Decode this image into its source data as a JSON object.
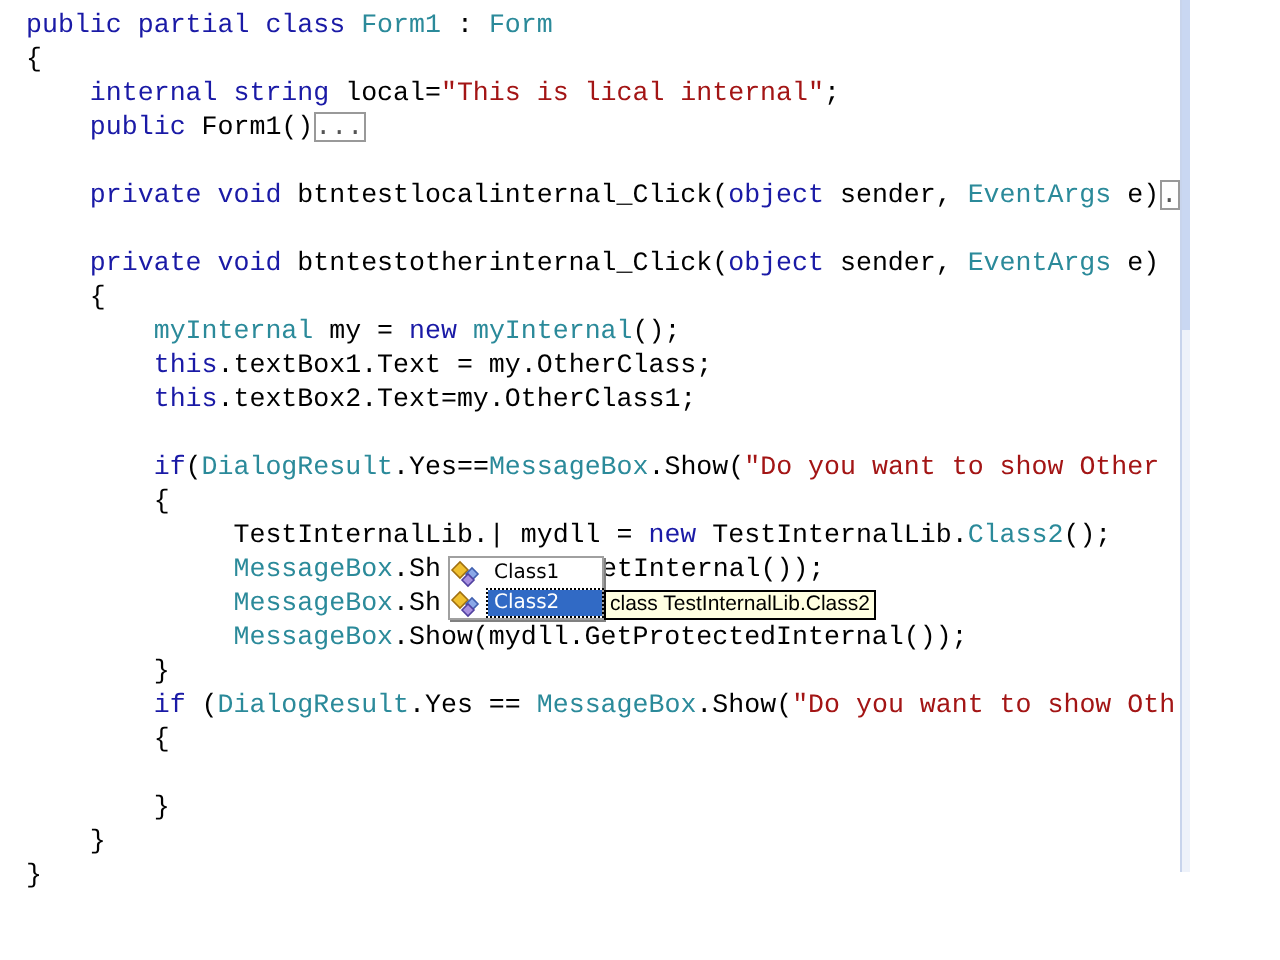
{
  "editor": {
    "lines": [
      {
        "tokens": [
          {
            "text": "public partial class ",
            "kind": "keyword"
          },
          {
            "text": "Form1",
            "kind": "type"
          },
          {
            "text": " : ",
            "kind": "plain"
          },
          {
            "text": "Form",
            "kind": "type"
          }
        ]
      },
      {
        "tokens": [
          {
            "text": "{",
            "kind": "plain"
          }
        ]
      },
      {
        "tokens": [
          {
            "text": "    internal string",
            "kind": "keyword"
          },
          {
            "text": " local=",
            "kind": "plain"
          },
          {
            "text": "\"This is lical internal\"",
            "kind": "string"
          },
          {
            "text": ";",
            "kind": "plain"
          }
        ]
      },
      {
        "tokens": [
          {
            "text": "    public",
            "kind": "keyword"
          },
          {
            "text": " Form1()",
            "kind": "plain"
          },
          {
            "text": "...",
            "kind": "collapsed"
          }
        ]
      },
      {
        "kind": "blank"
      },
      {
        "tokens": [
          {
            "text": "    private void",
            "kind": "keyword"
          },
          {
            "text": " btntestlocalinternal_Click(",
            "kind": "plain"
          },
          {
            "text": "object",
            "kind": "keyword"
          },
          {
            "text": " sender, ",
            "kind": "plain"
          },
          {
            "text": "EventArgs",
            "kind": "type"
          },
          {
            "text": " e)",
            "kind": "plain"
          },
          {
            "text": ".",
            "kind": "collapsed"
          }
        ]
      },
      {
        "kind": "blank"
      },
      {
        "tokens": [
          {
            "text": "    private void",
            "kind": "keyword"
          },
          {
            "text": " btntestotherinternal_Click(",
            "kind": "plain"
          },
          {
            "text": "object",
            "kind": "keyword"
          },
          {
            "text": " sender, ",
            "kind": "plain"
          },
          {
            "text": "EventArgs",
            "kind": "type"
          },
          {
            "text": " e)",
            "kind": "plain"
          }
        ]
      },
      {
        "tokens": [
          {
            "text": "    {",
            "kind": "plain"
          }
        ]
      },
      {
        "tokens": [
          {
            "text": "        myInternal",
            "kind": "type"
          },
          {
            "text": " my = ",
            "kind": "plain"
          },
          {
            "text": "new",
            "kind": "keyword"
          },
          {
            "text": " myInternal",
            "kind": "type"
          },
          {
            "text": "();",
            "kind": "plain"
          }
        ]
      },
      {
        "tokens": [
          {
            "text": "        this",
            "kind": "keyword"
          },
          {
            "text": ".textBox1.Text = my.OtherClass;",
            "kind": "plain"
          }
        ]
      },
      {
        "tokens": [
          {
            "text": "        this",
            "kind": "keyword"
          },
          {
            "text": ".textBox2.Text=my.OtherClass1;",
            "kind": "plain"
          }
        ]
      },
      {
        "kind": "blank"
      },
      {
        "tokens": [
          {
            "text": "        if",
            "kind": "keyword"
          },
          {
            "text": "(",
            "kind": "plain"
          },
          {
            "text": "DialogResult",
            "kind": "type"
          },
          {
            "text": ".Yes==",
            "kind": "plain"
          },
          {
            "text": "MessageBox",
            "kind": "type"
          },
          {
            "text": ".Show(",
            "kind": "plain"
          },
          {
            "text": "\"Do you want to show Other",
            "kind": "string"
          }
        ]
      },
      {
        "tokens": [
          {
            "text": "        {",
            "kind": "plain"
          }
        ]
      },
      {
        "tokens": [
          {
            "text": "             TestInternalLib.",
            "kind": "plain"
          },
          {
            "text": "|",
            "kind": "caret"
          },
          {
            "text": " mydll = ",
            "kind": "plain"
          },
          {
            "text": "new",
            "kind": "keyword"
          },
          {
            "text": " TestInternalLib.",
            "kind": "plain"
          },
          {
            "text": "Class2",
            "kind": "type"
          },
          {
            "text": "();",
            "kind": "plain"
          }
        ]
      },
      {
        "kind": "split",
        "tokens": [
          {
            "text": "             MessageBox",
            "kind": "type"
          },
          {
            "text": ".Sh",
            "kind": "plain"
          }
        ],
        "tail": [
          {
            "text": "etInternal());",
            "kind": "plain"
          }
        ]
      },
      {
        "tokens": [
          {
            "text": "             MessageBox",
            "kind": "type"
          },
          {
            "text": ".Sh",
            "kind": "plain"
          }
        ]
      },
      {
        "tokens": [
          {
            "text": "             MessageBox",
            "kind": "type"
          },
          {
            "text": ".Show(mydll.GetProtectedInternal());",
            "kind": "plain"
          }
        ]
      },
      {
        "tokens": [
          {
            "text": "        }",
            "kind": "plain"
          }
        ]
      },
      {
        "tokens": [
          {
            "text": "        if",
            "kind": "keyword"
          },
          {
            "text": " (",
            "kind": "plain"
          },
          {
            "text": "DialogResult",
            "kind": "type"
          },
          {
            "text": ".Yes == ",
            "kind": "plain"
          },
          {
            "text": "MessageBox",
            "kind": "type"
          },
          {
            "text": ".Show(",
            "kind": "plain"
          },
          {
            "text": "\"Do you want to show Oth",
            "kind": "string"
          }
        ]
      },
      {
        "tokens": [
          {
            "text": "        {",
            "kind": "plain"
          }
        ]
      },
      {
        "kind": "blank"
      },
      {
        "tokens": [
          {
            "text": "        }",
            "kind": "plain"
          }
        ]
      },
      {
        "tokens": [
          {
            "text": "    }",
            "kind": "plain"
          }
        ]
      },
      {
        "tokens": [
          {
            "text": "}",
            "kind": "plain"
          }
        ]
      }
    ]
  },
  "completion": {
    "items": [
      {
        "label": "Class1",
        "selected": false
      },
      {
        "label": "Class2",
        "selected": true
      }
    ]
  },
  "tooltip": {
    "text": "class TestInternalLib.Class2"
  }
}
